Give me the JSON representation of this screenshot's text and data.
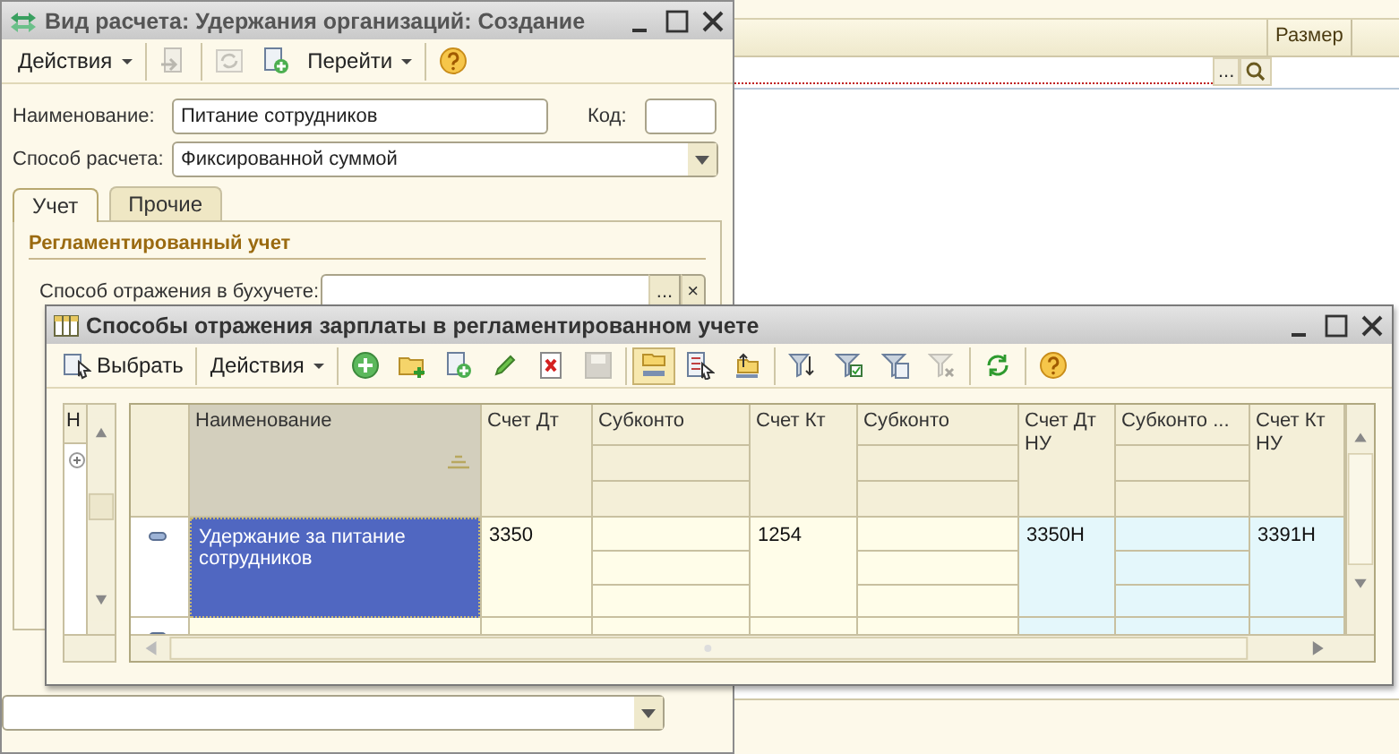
{
  "background_list": {
    "columns": [
      {
        "label": "Размер"
      }
    ],
    "filter_field": {
      "select_button": "..."
    }
  },
  "form_window": {
    "title": "Вид расчета: Удержания организаций: Создание",
    "toolbar": [
      [
        {
          "kind": "menu",
          "label": "Действия",
          "disabled": false
        }
      ],
      [
        {
          "kind": "post-close",
          "disabled": true
        }
      ],
      [
        {
          "kind": "reread",
          "disabled": true
        },
        {
          "kind": "copy-new",
          "disabled": false
        },
        {
          "kind": "menu",
          "label": "Перейти",
          "disabled": false
        }
      ],
      [
        {
          "kind": "help",
          "disabled": false
        }
      ]
    ],
    "name_field": {
      "label": "Наименование:",
      "value": "Питание сотрудников"
    },
    "code_field": {
      "label": "Код:"
    },
    "calc_method": {
      "label": "Способ расчета:",
      "value": "Фиксированной суммой"
    },
    "tabs": [
      {
        "label": "Учет",
        "selected": true
      },
      {
        "label": "Прочие",
        "selected": false
      }
    ],
    "section_title": "Регламентированный учет",
    "accounting_field": {
      "label": "Способ отражения в бухучете:",
      "select_button": "...",
      "clear_button": "×"
    }
  },
  "dialog": {
    "title": "Способы отражения зарплаты в регламентированном учете",
    "toolbar": [
      [
        {
          "kind": "labeled",
          "label": "Выбрать",
          "disabled": false,
          "pressed": false
        }
      ],
      [
        {
          "kind": "menu",
          "label": "Действия",
          "disabled": false,
          "pressed": false
        }
      ],
      [
        {
          "kind": "add",
          "disabled": false,
          "pressed": false
        },
        {
          "kind": "add-folder",
          "disabled": false,
          "pressed": false
        },
        {
          "kind": "copy",
          "disabled": false,
          "pressed": false
        },
        {
          "kind": "edit",
          "disabled": false,
          "pressed": false
        },
        {
          "kind": "delete",
          "disabled": false,
          "pressed": false
        },
        {
          "kind": "save",
          "disabled": true,
          "pressed": false
        }
      ],
      [
        {
          "kind": "hierarchy",
          "disabled": false,
          "pressed": true
        },
        {
          "kind": "list-select",
          "disabled": false,
          "pressed": false
        },
        {
          "kind": "to-parent",
          "disabled": false,
          "pressed": false
        }
      ],
      [
        {
          "kind": "filter-set",
          "disabled": false,
          "pressed": false
        },
        {
          "kind": "filter-check",
          "disabled": false,
          "pressed": false
        },
        {
          "kind": "filter-menu",
          "disabled": false,
          "pressed": false
        },
        {
          "kind": "filter-clear",
          "disabled": true,
          "pressed": false
        }
      ],
      [
        {
          "kind": "refresh",
          "disabled": false,
          "pressed": false
        }
      ],
      [
        {
          "kind": "help",
          "disabled": false,
          "pressed": false
        }
      ]
    ],
    "side_table": {
      "columns": [
        {
          "label": "Н"
        }
      ]
    },
    "grid": {
      "columns": [
        {
          "label": "Наименование",
          "kind": "name",
          "sorted": true,
          "highlighted": false
        },
        {
          "label": "Счет Дт",
          "kind": "account",
          "sorted": false,
          "highlighted": false
        },
        {
          "label": "Субконто",
          "kind": "subconto",
          "sorted": false,
          "highlighted": false
        },
        {
          "label": "Счет Кт",
          "kind": "account",
          "sorted": false,
          "highlighted": false
        },
        {
          "label": "Субконто",
          "kind": "subconto",
          "sorted": false,
          "highlighted": false
        },
        {
          "label": "Счет Дт НУ",
          "kind": "account",
          "sorted": false,
          "highlighted": true
        },
        {
          "label": "Субконто ...",
          "kind": "subconto",
          "sorted": false,
          "highlighted": true
        },
        {
          "label": "Счет Кт НУ",
          "kind": "account",
          "sorted": false,
          "highlighted": true
        }
      ],
      "rows": [
        {
          "selected": true,
          "cells": [
            "Удержание за питание сотрудников",
            "3350",
            null,
            "1254",
            null,
            "3350Н",
            null,
            "3391Н"
          ]
        },
        {
          "selected": false
        }
      ]
    }
  }
}
